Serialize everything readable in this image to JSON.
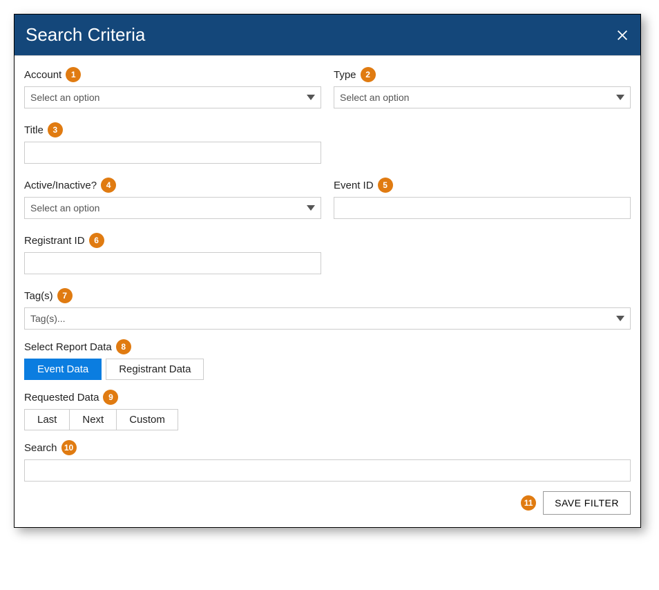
{
  "header": {
    "title": "Search Criteria"
  },
  "badges": {
    "account": "1",
    "type": "2",
    "title": "3",
    "active": "4",
    "eventId": "5",
    "registrantId": "6",
    "tags": "7",
    "reportData": "8",
    "requestedData": "9",
    "search": "10",
    "save": "11"
  },
  "labels": {
    "account": "Account",
    "type": "Type",
    "title": "Title",
    "active": "Active/Inactive?",
    "eventId": "Event ID",
    "registrantId": "Registrant ID",
    "tags": "Tag(s)",
    "reportData": "Select Report Data",
    "requestedData": "Requested Data",
    "search": "Search"
  },
  "selects": {
    "account_placeholder": "Select an option",
    "type_placeholder": "Select an option",
    "active_placeholder": "Select an option",
    "tags_placeholder": "Tag(s)..."
  },
  "reportDataButtons": {
    "event": "Event Data",
    "registrant": "Registrant Data"
  },
  "requestedDataButtons": {
    "last": "Last",
    "next": "Next",
    "custom": "Custom"
  },
  "footer": {
    "save": "SAVE FILTER"
  }
}
